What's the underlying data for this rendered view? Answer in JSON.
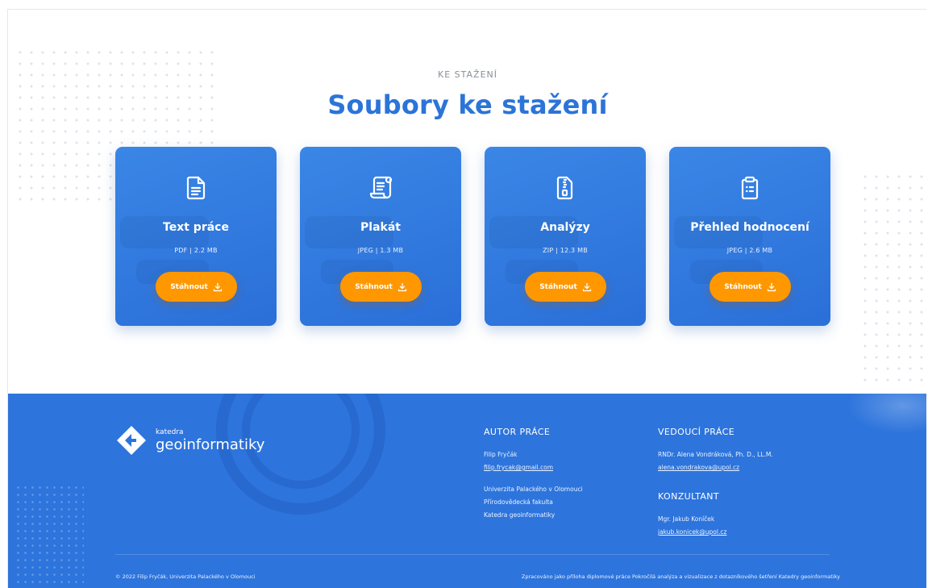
{
  "section": {
    "eyebrow": "KE STAŽENÍ",
    "title": "Soubory ke stažení"
  },
  "cards": [
    {
      "icon": "document-icon",
      "name": "Text práce",
      "meta": "PDF | 2.2 MB",
      "button": "Stáhnout"
    },
    {
      "icon": "scroll-icon",
      "name": "Plakát",
      "meta": "JPEG | 1.3 MB",
      "button": "Stáhnout"
    },
    {
      "icon": "zip-file-icon",
      "name": "Analýzy",
      "meta": "ZIP | 12.3 MB",
      "button": "Stáhnout"
    },
    {
      "icon": "clipboard-icon",
      "name": "Přehled hodnocení",
      "meta": "JPEG | 2.6 MB",
      "button": "Stáhnout"
    }
  ],
  "footer": {
    "logo": {
      "small": "katedra",
      "big": "geoinformatiky"
    },
    "author": {
      "heading": "AUTOR PRÁCE",
      "name": "Filip Fryčák",
      "email": "filip.frycak@gmail.com",
      "university": "Univerzita Palackého v Olomouci",
      "faculty": "Přírodovědecká fakulta",
      "department": "Katedra geoinformatiky"
    },
    "supervisor": {
      "heading": "VEDOUCÍ PRÁCE",
      "name": "RNDr. Alena Vondráková, Ph. D., LL.M.",
      "email": "alena.vondrakova@upol.cz"
    },
    "consultant": {
      "heading": "KONZULTANT",
      "name": "Mgr. Jakub Koníček",
      "email": "jakub.konicek@upol.cz"
    },
    "copyright": "© 2022 Filip Fryčák, Univerzita Palackého v Olomouci",
    "note": "Zpracováno jako příloha diplomové práce Pokročilá analýza a vizualizace z dotazníkového šetření Katedry geoinformatiky"
  },
  "colors": {
    "primary": "#2b74d8",
    "button": "#ff9800",
    "footer": "#2d74dc"
  }
}
